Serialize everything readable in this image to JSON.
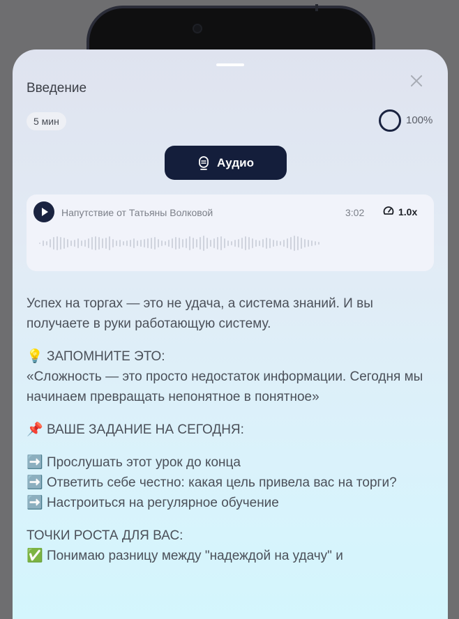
{
  "sheet": {
    "title": "Введение",
    "duration": "5 мин",
    "progress_text": "100%",
    "progress": 1.0,
    "audio_button_label": "Аудио"
  },
  "player": {
    "track_title": "Напутствие от Татьяны Волковой",
    "time": "3:02",
    "speed": "1.0x",
    "played_fraction": 0.0
  },
  "content": {
    "intro": "Успех на торгах — это не удача, а система знаний. И вы получаете в руки работающую систему.",
    "remember_emoji": "💡",
    "remember_heading": "ЗАПОМНИТЕ ЭТО:",
    "quote": "«Сложность — это просто недостаток информации. Сегодня мы начинаем превращать непонятное в понятное»",
    "task_emoji": "📌",
    "task_heading": "ВАШЕ ЗАДАНИЕ НА СЕГОДНЯ:",
    "tasks": [
      {
        "emoji": "➡️",
        "text": "Прослушать этот урок до конца"
      },
      {
        "emoji": "➡️",
        "text": "Ответить себе честно: какая цель привела вас на торги?"
      },
      {
        "emoji": "➡️",
        "text": "Настроиться на регулярное обучение"
      }
    ],
    "growth_heading": "ТОЧКИ РОСТА ДЛЯ ВАС:",
    "growth_items": [
      {
        "emoji": "✅",
        "text": "Понимаю разницу между \"надеждой на удачу\" и"
      }
    ]
  },
  "icons": {
    "close": "close-icon",
    "audio": "microphone-icon",
    "play": "play-icon",
    "speed": "speedometer-icon"
  },
  "colors": {
    "accent": "#141e3b",
    "text": "#4b5059"
  }
}
